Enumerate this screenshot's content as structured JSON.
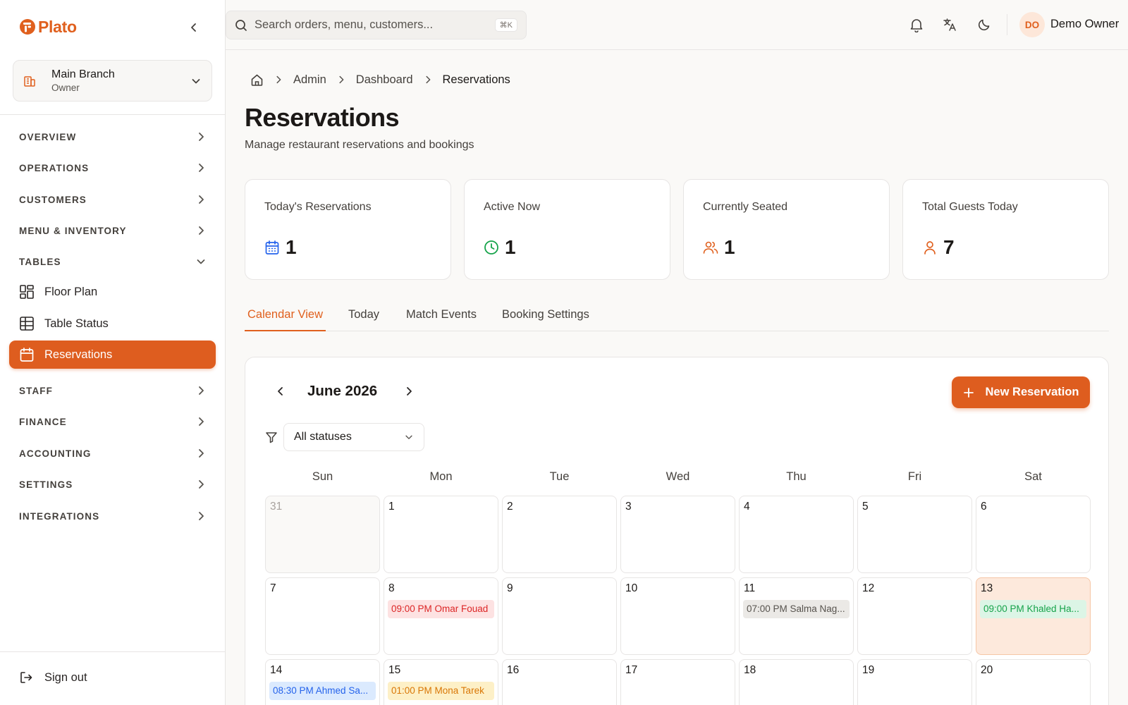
{
  "brand": {
    "name": "Plato",
    "accent": "#de5d1f"
  },
  "branch": {
    "name": "Main Branch",
    "role": "Owner"
  },
  "nav": {
    "overview": "OVERVIEW",
    "operations": "OPERATIONS",
    "customers": "CUSTOMERS",
    "menu_inventory": "MENU & INVENTORY",
    "tables": "TABLES",
    "floor_plan": "Floor Plan",
    "table_status": "Table Status",
    "reservations": "Reservations",
    "staff": "STAFF",
    "finance": "FINANCE",
    "accounting": "ACCOUNTING",
    "settings": "SETTINGS",
    "integrations": "INTEGRATIONS",
    "sign_out": "Sign out"
  },
  "header": {
    "search_placeholder": "Search orders, menu, customers...",
    "shortcut": "⌘K",
    "user_initials": "DO",
    "user_name": "Demo Owner"
  },
  "breadcrumb": {
    "admin": "Admin",
    "dashboard": "Dashboard",
    "current": "Reservations"
  },
  "page": {
    "title": "Reservations",
    "subtitle": "Manage restaurant reservations and bookings"
  },
  "stats": [
    {
      "label": "Today's Reservations",
      "value": "1",
      "icon": "calendar-icon",
      "color": "#2563eb"
    },
    {
      "label": "Active Now",
      "value": "1",
      "icon": "clock-icon",
      "color": "#16a34a"
    },
    {
      "label": "Currently Seated",
      "value": "1",
      "icon": "users-icon",
      "color": "#e0601e"
    },
    {
      "label": "Total Guests Today",
      "value": "7",
      "icon": "user-icon",
      "color": "#e0601e"
    }
  ],
  "tabs": [
    "Calendar View",
    "Today",
    "Match Events",
    "Booking Settings"
  ],
  "calendar": {
    "month_label": "June 2026",
    "new_button": "New Reservation",
    "status_filter": "All statuses",
    "weekdays": [
      "Sun",
      "Mon",
      "Tue",
      "Wed",
      "Thu",
      "Fri",
      "Sat"
    ],
    "weeks": [
      [
        {
          "day": "31",
          "muted": true
        },
        {
          "day": "1"
        },
        {
          "day": "2"
        },
        {
          "day": "3"
        },
        {
          "day": "4"
        },
        {
          "day": "5"
        },
        {
          "day": "6"
        }
      ],
      [
        {
          "day": "7"
        },
        {
          "day": "8",
          "event": "09:00 PM Omar Fouad",
          "status": "cancelled"
        },
        {
          "day": "9"
        },
        {
          "day": "10"
        },
        {
          "day": "11",
          "event": "07:00 PM Salma Nag...",
          "status": "completed"
        },
        {
          "day": "12"
        },
        {
          "day": "13",
          "today": true,
          "event": "09:00 PM Khaled Ha...",
          "status": "seated"
        }
      ],
      [
        {
          "day": "14",
          "event": "08:30 PM Ahmed Sa...",
          "status": "confirmed"
        },
        {
          "day": "15",
          "event": "01:00 PM Mona Tarek",
          "status": "pending"
        },
        {
          "day": "16"
        },
        {
          "day": "17"
        },
        {
          "day": "18"
        },
        {
          "day": "19"
        },
        {
          "day": "20"
        }
      ]
    ],
    "status_colors": {
      "cancelled": {
        "bg": "#fde2e2",
        "fg": "#dc2626"
      },
      "completed": {
        "bg": "#ebe9e6",
        "fg": "#57534e"
      },
      "seated": {
        "bg": "#dcf5e6",
        "fg": "#16a34a"
      },
      "confirmed": {
        "bg": "#dbeafe",
        "fg": "#2563eb"
      },
      "pending": {
        "bg": "#fdf0c7",
        "fg": "#d97706"
      }
    }
  }
}
